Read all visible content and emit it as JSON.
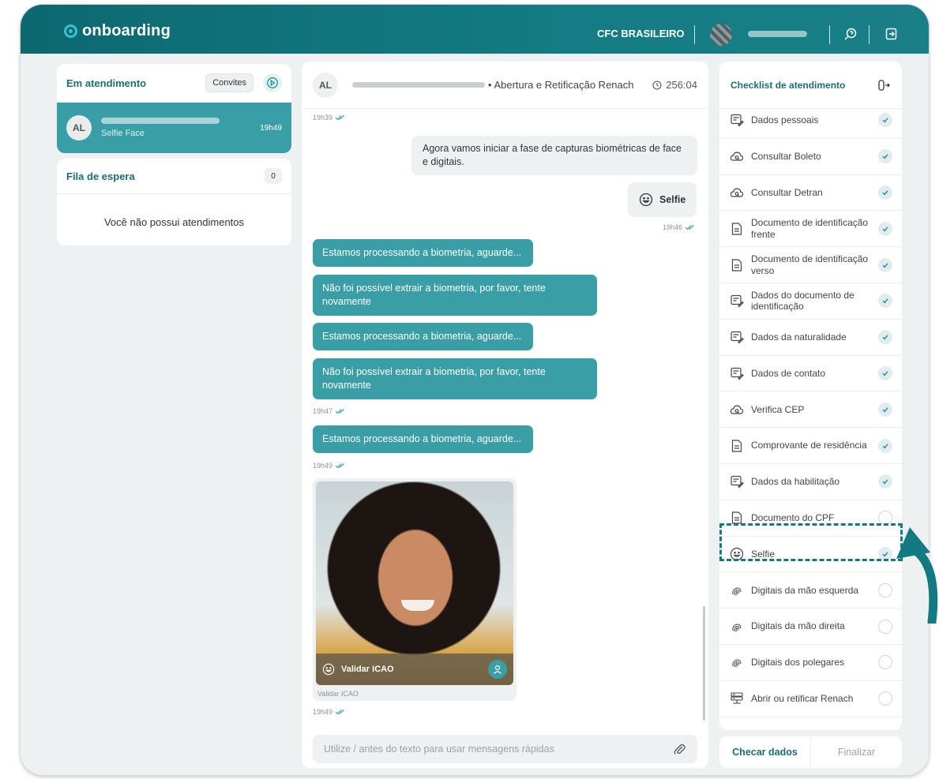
{
  "header": {
    "logo_text": "onboarding",
    "org_name": "CFC BRASILEIRO"
  },
  "queue": {
    "title": "Em atendimento",
    "invites_label": "Convites",
    "active": {
      "initials": "AL",
      "subtitle": "Selfie Face",
      "time": "19h49"
    }
  },
  "waiting": {
    "title": "Fila de espera",
    "count": "0",
    "empty_message": "Você não possui atendimentos"
  },
  "chat": {
    "initials": "AL",
    "subject": "• Abertura e Retificação Renach",
    "timer": "256:04",
    "messages": {
      "ts1": "19h39",
      "out1": "Agora vamos iniciar a fase de capturas biométricas de face e digitais.",
      "selfie_label": "Selfie",
      "ts2": "19h46",
      "in1": "Estamos processando a biometria, aguarde...",
      "in2": "Não foi possível extrair a biometria, por favor, tente novamente",
      "in3": "Estamos processando a biometria, aguarde...",
      "in4": "Não foi possível extrair a biometria, por favor, tente novamente",
      "ts3": "19h47",
      "in5": "Estamos processando a biometria, aguarde...",
      "ts4": "19h49",
      "photo_action": "Validar ICAO",
      "photo_caption": "Validar ICAO",
      "ts5": "19h49"
    },
    "composer_placeholder": "Utilize / antes do texto para usar mensagens rápidas"
  },
  "checklist": {
    "title": "Checklist de atendimento",
    "items": [
      {
        "label": "Dados pessoais",
        "icon": "form-icon",
        "done": true
      },
      {
        "label": "Consultar Boleto",
        "icon": "cloud-search-icon",
        "done": true
      },
      {
        "label": "Consultar Detran",
        "icon": "cloud-search-icon",
        "done": true
      },
      {
        "label": "Documento de identificação frente",
        "icon": "document-icon",
        "done": true
      },
      {
        "label": "Documento de identificação verso",
        "icon": "document-icon",
        "done": true
      },
      {
        "label": "Dados do documento de identificação",
        "icon": "form-icon",
        "done": true
      },
      {
        "label": "Dados da naturalidade",
        "icon": "form-icon",
        "done": true
      },
      {
        "label": "Dados de contato",
        "icon": "form-icon",
        "done": true
      },
      {
        "label": "Verifica CEP",
        "icon": "cloud-search-icon",
        "done": true
      },
      {
        "label": "Comprovante de residência",
        "icon": "document-icon",
        "done": true
      },
      {
        "label": "Dados da habilitação",
        "icon": "form-icon",
        "done": true
      },
      {
        "label": "Documento do CPF",
        "icon": "document-icon",
        "done": false
      },
      {
        "label": "Selfie",
        "icon": "smiley-icon",
        "done": true
      },
      {
        "label": "Digitais da mão esquerda",
        "icon": "fingerprint-icon",
        "done": false
      },
      {
        "label": "Digitais da mão direita",
        "icon": "fingerprint-icon",
        "done": false
      },
      {
        "label": "Digitais dos polegares",
        "icon": "fingerprint-icon",
        "done": false
      },
      {
        "label": "Abrir ou retificar Renach",
        "icon": "server-icon",
        "done": false
      }
    ],
    "check_data_label": "Checar dados",
    "finish_label": "Finalizar"
  },
  "colors": {
    "brand": "#147c84",
    "accent": "#3a9ea6",
    "highlight": "#137a82"
  }
}
